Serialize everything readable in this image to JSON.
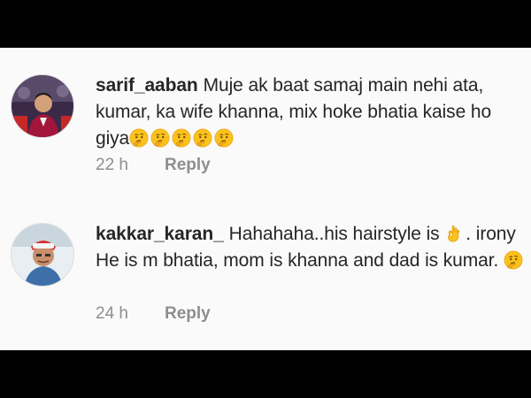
{
  "comments": [
    {
      "username": "sarif_aaban",
      "text": "Muje ak baat samaj main nehi ata, kumar,  ka wife khanna,  mix hoke bhatia kaise ho giya",
      "emojis": [
        "thinking-face",
        "thinking-face",
        "thinking-face",
        "thinking-face",
        "thinking-face"
      ],
      "time": "22 h",
      "reply_label": "Reply"
    },
    {
      "username": "kakkar_karan_",
      "text_before_emoji": "Hahahaha..his hairstyle is",
      "emoji_inline": "ok-hand",
      "text_after_emoji": ". irony He is m bhatia, mom is khanna and dad is kumar.",
      "emoji_end": "thinking-face",
      "time": "24 h",
      "reply_label": "Reply"
    }
  ],
  "colors": {
    "background": "#fafafa",
    "text": "#262626",
    "secondary_text": "#8e8e8e",
    "letterbox": "#000000"
  }
}
